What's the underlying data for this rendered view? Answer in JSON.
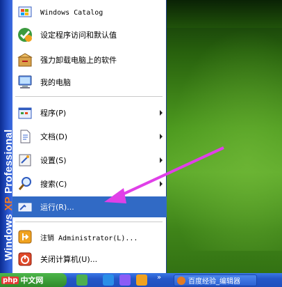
{
  "menu": {
    "band": {
      "brand": "Windows",
      "xp": "XP",
      "edition": "Professional"
    },
    "pinned": [
      {
        "label": "Windows Catalog",
        "icon": "windows-catalog-icon"
      },
      {
        "label": "设定程序访问和默认值",
        "icon": "program-access-icon"
      },
      {
        "label": "强力卸载电脑上的软件",
        "icon": "uninstall-box-icon"
      },
      {
        "label": "我的电脑",
        "icon": "my-computer-icon"
      }
    ],
    "items": [
      {
        "label": "程序(P)",
        "icon": "programs-icon",
        "submenu": true
      },
      {
        "label": "文档(D)",
        "icon": "documents-icon",
        "submenu": true
      },
      {
        "label": "设置(S)",
        "icon": "settings-icon",
        "submenu": true
      },
      {
        "label": "搜索(C)",
        "icon": "search-icon",
        "submenu": true
      },
      {
        "label": "运行(R)...",
        "icon": "run-icon",
        "submenu": false,
        "highlighted": true
      }
    ],
    "session": [
      {
        "label": "注销 Administrator(L)...",
        "icon": "logoff-icon"
      },
      {
        "label": "关闭计算机(U)...",
        "icon": "shutdown-icon"
      }
    ]
  },
  "taskbar": {
    "watermark": "php中文网",
    "watermark_badge": "php",
    "watermark_text": "中文网",
    "overflow": "»",
    "task_button": "百度经验_编辑器"
  },
  "colors": {
    "band": "#2c5ad3",
    "highlight": "#316ac5",
    "annotation": "#e040e8",
    "taskbar": "#2457c9"
  }
}
